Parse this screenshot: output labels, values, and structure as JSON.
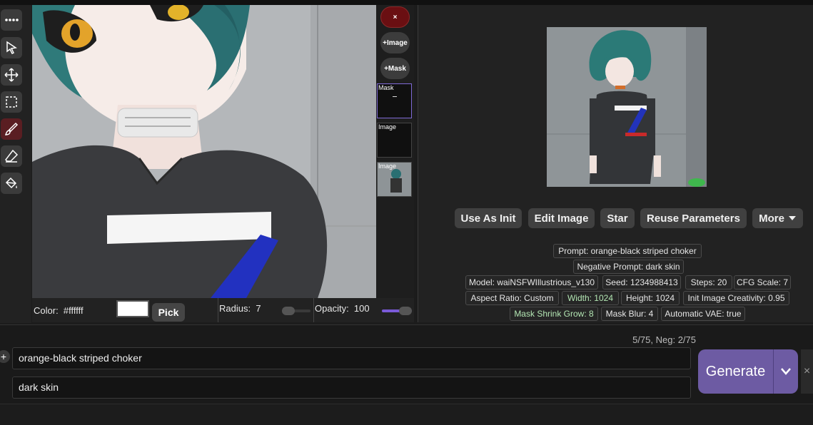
{
  "toolbar": {
    "tools": [
      {
        "icon": "more-dots-icon"
      },
      {
        "icon": "cursor-icon"
      },
      {
        "icon": "move-icon"
      },
      {
        "icon": "select-rect-icon"
      },
      {
        "icon": "brush-icon",
        "active": true
      },
      {
        "icon": "eraser-icon"
      },
      {
        "icon": "paint-bucket-icon"
      }
    ]
  },
  "layers": {
    "close_label": "×",
    "add_image_label": "+Image",
    "add_mask_label": "+Mask",
    "items": [
      {
        "label": "Mask",
        "selected": true
      },
      {
        "label": "Image"
      },
      {
        "label": "Image"
      }
    ]
  },
  "canvas_controls": {
    "color_label": "Color:",
    "color_value": "#ffffff",
    "pick_label": "Pick",
    "radius_label": "Radius:",
    "radius_value": "7",
    "opacity_label": "Opacity:",
    "opacity_value": "100",
    "radius_fraction": 0.35,
    "opacity_fraction": 1.0
  },
  "result": {
    "actions": [
      "Use As Init",
      "Edit Image",
      "Star",
      "Reuse Parameters",
      "More"
    ],
    "more_icon": "chevron-down-icon",
    "params": {
      "prompt": "Prompt: orange-black striped choker",
      "negative_prompt": "Negative Prompt: dark skin",
      "model": "Model: waiNSFWIllustrious_v130",
      "seed": "Seed: 1234988413",
      "steps": "Steps: 20",
      "cfg": "CFG Scale: 7",
      "aspect": "Aspect Ratio: Custom",
      "width": "Width: 1024",
      "height": "Height: 1024",
      "init_creativity": "Init Image Creativity: 0.95",
      "mask_shrink": "Mask Shrink Grow: 8",
      "mask_blur": "Mask Blur: 4",
      "auto_vae": "Automatic VAE: true"
    }
  },
  "prompt_area": {
    "token_count": "5/75, Neg: 2/75",
    "positive": "orange-black striped choker",
    "negative": "dark skin",
    "generate_label": "Generate",
    "generate_accent": "#6d5ba3"
  }
}
